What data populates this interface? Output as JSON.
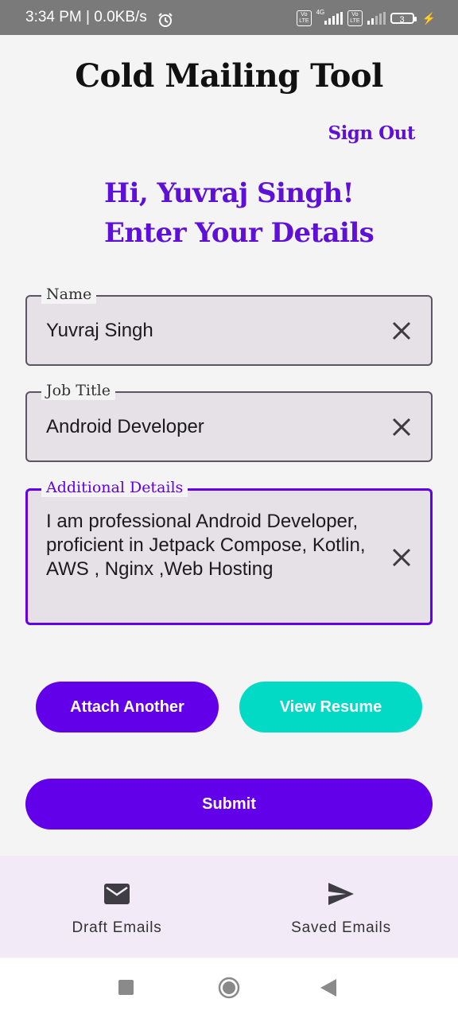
{
  "status_bar": {
    "time_speed": "3:34 PM | 0.0KB/s",
    "sim1_badge": "Vo\nLTE",
    "network_type": "4G",
    "sim2_badge": "Vo\nLTE",
    "battery_level": "3"
  },
  "header": {
    "title": "Cold Mailing Tool",
    "sign_out": "Sign Out"
  },
  "greeting": {
    "line1": "Hi, Yuvraj Singh!",
    "line2": "Enter Your Details"
  },
  "form": {
    "name": {
      "label": "Name",
      "value": "Yuvraj Singh"
    },
    "job_title": {
      "label": "Job Title",
      "value": "Android Developer"
    },
    "additional_details": {
      "label": "Additional Details",
      "value": "I am professional Android Developer, proficient in Jetpack Compose, Kotlin, AWS , Nginx ,Web Hosting"
    }
  },
  "actions": {
    "attach_another": "Attach Another",
    "view_resume": "View Resume",
    "submit": "Submit"
  },
  "bottom_nav": {
    "draft_emails": "Draft Emails",
    "saved_emails": "Saved Emails"
  },
  "colors": {
    "primary": "#6200ea",
    "secondary": "#03dac5",
    "background": "#f4f4f5",
    "field_fill": "#e6e1e7",
    "nav_background": "#f2ebf7"
  },
  "icons": {
    "field_clear": "close-icon",
    "draft_emails": "mail-icon",
    "saved_emails": "send-icon",
    "status_alarm": "alarm-icon"
  }
}
